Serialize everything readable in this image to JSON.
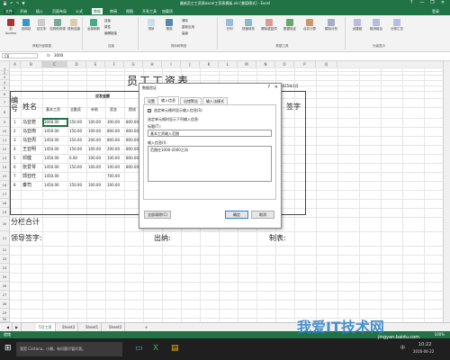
{
  "window": {
    "title": "最新员工工资表excel工资表模板.xls [兼容模式] - Excel",
    "qat": "💾 ↶ ↷ ▼",
    "controls": [
      "?",
      "—",
      "❐",
      "✕"
    ]
  },
  "menu": {
    "tabs": [
      "文件",
      "开始",
      "插入",
      "页面布局",
      "公式",
      "数据",
      "审阅",
      "视图",
      "开发工具",
      "加载项"
    ],
    "active": "数据",
    "account": "登录"
  },
  "ribbon": {
    "groups": [
      {
        "label": "获取外部数据",
        "buttons": [
          "自 Access",
          "自网站",
          "自文本",
          "自其他来源",
          "现有连接"
        ]
      },
      {
        "label": "连接",
        "buttons": [
          "全部刷新",
          "连接",
          "属性",
          "编辑链接"
        ]
      },
      {
        "label": "排序和筛选",
        "buttons": [
          "排序",
          "筛选",
          "清除",
          "重新应用",
          "高级"
        ]
      },
      {
        "label": "数据工具",
        "buttons": [
          "分列",
          "快速填充",
          "删除重复项",
          "数据验证",
          "合并计算",
          "模拟分析"
        ]
      },
      {
        "label": "分级显示",
        "buttons": [
          "创建组",
          "取消组合",
          "分类汇总"
        ]
      }
    ]
  },
  "formula_bar": {
    "name_box": "C6",
    "fx": "fx",
    "content": "3000"
  },
  "sheet": {
    "columns": [
      "A",
      "B",
      "C",
      "D",
      "E",
      "F",
      "G",
      "H",
      "I",
      "J",
      "K",
      "L",
      "M",
      "N",
      "O",
      "P",
      "Q"
    ],
    "rows": [
      "1",
      "2",
      "3",
      "4",
      "5",
      "6",
      "7",
      "8",
      "9",
      "10",
      "11",
      "12",
      "13",
      "14",
      "15",
      "16",
      "17",
      "18",
      "19",
      "20",
      "21",
      "22",
      "23",
      "24",
      "25",
      "26",
      "27",
      "28",
      "29",
      "30",
      "31"
    ],
    "title": "员工工资表",
    "date": "2015年1月",
    "header_num": "编号",
    "header_name": "姓名",
    "header_group": "应发金额",
    "sub_headers": [
      "基本工资",
      "全勤奖",
      "补助",
      "奖金",
      "提成"
    ],
    "header_sign": "签字",
    "data_rows": [
      {
        "no": "1",
        "name": "马亚若",
        "vals": [
          "3000.00",
          "150.00",
          "100.00",
          "300.00",
          "800.00"
        ]
      },
      {
        "no": "2",
        "name": "马亚南",
        "vals": [
          "1450.00",
          "150.00",
          "100.00",
          "800.00",
          "800.00"
        ]
      },
      {
        "no": "3",
        "name": "马亚周",
        "vals": [
          "1450.00",
          "150.00",
          "200.00",
          "800.00",
          "800.00"
        ]
      },
      {
        "no": "4",
        "name": "王亚明",
        "vals": [
          "1450.00",
          "150.00",
          "100.00",
          "200.00",
          "800.00"
        ]
      },
      {
        "no": "5",
        "name": "邓健",
        "vals": [
          "1450.00",
          "0.00",
          "100.00",
          "100.00",
          "800.00"
        ]
      },
      {
        "no": "6",
        "name": "张爱琴",
        "vals": [
          "1450.00",
          "150.00",
          "100.00",
          "100.00",
          "800.00"
        ]
      },
      {
        "no": "7",
        "name": "郭亚旺",
        "vals": [
          "1450.00",
          "",
          "",
          "700.00",
          ""
        ]
      },
      {
        "no": "8",
        "name": "秦司",
        "vals": [
          "1450.00",
          "150.00",
          "100.00",
          "100.00",
          ""
        ]
      }
    ],
    "subtotal": "分栏合计",
    "footer_leader": "领导签字:",
    "footer_cashier": "出纳:",
    "footer_maker": "制表:"
  },
  "dialog": {
    "title": "数据验证",
    "help": "?",
    "close": "✕",
    "tabs": [
      "设置",
      "输入信息",
      "出错警告",
      "输入法模式"
    ],
    "active_tab": "输入信息",
    "checkbox_label": "选定单元格时显示输入信息(S)",
    "checkbox_checked": true,
    "hint": "选定单元格时显示下列输入信息:",
    "title_label": "标题(T):",
    "title_value": "基本工资输入范围",
    "message_label": "输入信息(I):",
    "message_value": "范围在1000-2000之间",
    "clear_all": "全部清除(C)",
    "ok": "确定",
    "cancel": "取消"
  },
  "sheet_tabs": {
    "tabs": [
      "5月工资",
      "Sheet3",
      "Sheet1",
      "Sheet2"
    ],
    "active": "5月工资",
    "add": "+"
  },
  "status_bar": {
    "ready": "就绪",
    "zoom": "100%"
  },
  "taskbar": {
    "search": "我是 Cortana，小娜。有问题尽管问我。",
    "time": "10:22",
    "date": "2016-04-22",
    "lang": "中"
  },
  "watermark": {
    "text": "我爱IT技术网",
    "url": "jingyan.baidu.com"
  }
}
